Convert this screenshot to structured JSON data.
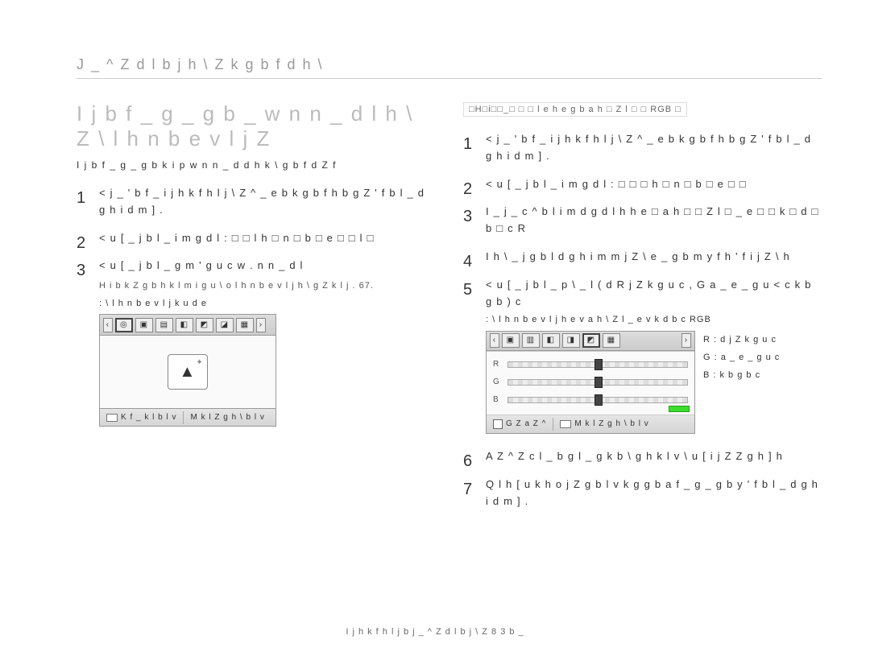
{
  "side_head": "J _ ^ Z d l b j h \\ Z k g b f d h \\",
  "title": "I j b f _ g _ g b _  w n n _ d l h \\  Z \\ l h n b e v l j Z",
  "subtitle": "I j b f _ g _ g b k  i  p w n n _ d d h k \\ g b f d Z f",
  "left_steps": [
    "< j _ ' b f _  i j h k f h l j \\ Z ^ _ e b k g b f h b g Z ' f b l _   d g h i d m   ] .",
    "< u [ _ j b l _  i m g d l  : □ □ l h □ n □ b □ e □ □ l □",
    "< u [ _ j b l _  g m ' g u c  w . n n _ d l"
  ],
  "left_substep": "H i b k Z g b h k l m i g u \\ o  l h n b e v l j h \\ g Z  k l j . 67.",
  "panel1_caption": ": \\ l h n b e v l j k  u d e",
  "panel1_foot_left": "K f _ k l b l v",
  "panel1_foot_right": "M k l Z g h \\ b l v",
  "note_box": "□H□i□□_□ □ □ l e h  e g  b a  h □  Z l □ □ RGB □",
  "right_steps": [
    "< j _ ' b f _  i j h k f h l j \\ Z ^ _ e b k g b f h b g Z ' f b l _   d g h i d m   ] .",
    "< u [ _ j b l _  i m g d l  : □ □ □ h □ n □ b □ e □ □",
    "I _ j _ c ^ b l i m d g d l h h  e  □ a  h □ □ Z l □ _ e □ □ k □ d □ b □ c R",
    "I h \\ _ j g b l d g h i m m j Z \\ e _ g b m y f h ' f i j Z \\ h",
    "< u [ _ j b l _  p \\ _ l  ( d R j Z k g u c , G a _ e _ g u < c k b g b ) c"
  ],
  "panel2_caption": ": \\ l h n b e v l j h  e  v a h \\ Z l _ e v k d b c RGB",
  "rgb": {
    "R": {
      "label": "R",
      "pos": 48
    },
    "G": {
      "label": "G",
      "pos": 48
    },
    "B": {
      "label": "B",
      "pos": 48
    }
  },
  "panel2_foot_left": "G Z a Z ^",
  "panel2_foot_right": "M k l Z g h \\ b l v",
  "legend": {
    "R": "R : d j Z k g u c",
    "G": "G : a _ e _ g u c",
    "B": "B : k b g b c"
  },
  "post_steps": [
    "A Z ^ Z c l _  b g l _ g k b \\ g h k l v \\ u [ i j Z Z g h ] h",
    "Q l h [ u  k h o j Z g b l v k  g g b a f _ g _ g b y ' f b l _   d g h i d m ] ."
  ],
  "post_start": 6,
  "footer": "I j h k f h l j  b  j _ ^ Z d l b j \\ Z 8 3 b _"
}
